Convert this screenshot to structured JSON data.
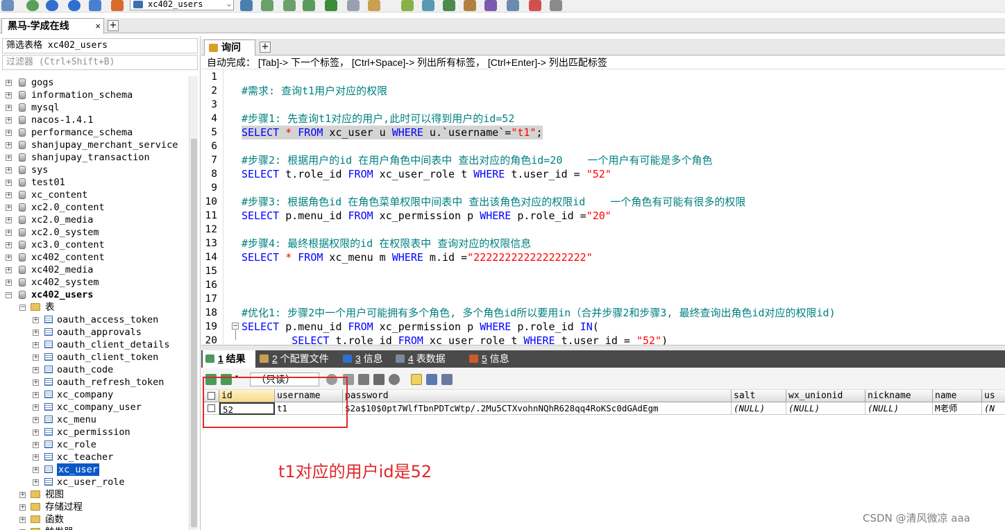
{
  "toolbar": {
    "db_select": "xc402_users"
  },
  "connection_tab": {
    "label": "黑马-学成在线",
    "close": "×"
  },
  "left_panel": {
    "filter_table": "筛选表格 xc402_users",
    "filter_placeholder": "过滤器 (Ctrl+Shift+B)",
    "databases": [
      "gogs",
      "information_schema",
      "mysql",
      "nacos-1.4.1",
      "performance_schema",
      "shanjupay_merchant_service",
      "shanjupay_transaction",
      "sys",
      "test01",
      "xc_content",
      "xc2.0_content",
      "xc2.0_media",
      "xc2.0_system",
      "xc3.0_content",
      "xc402_content",
      "xc402_media",
      "xc402_system",
      "xc402_users"
    ],
    "tables_folder": "表",
    "tables": [
      "oauth_access_token",
      "oauth_approvals",
      "oauth_client_details",
      "oauth_client_token",
      "oauth_code",
      "oauth_refresh_token",
      "xc_company",
      "xc_company_user",
      "xc_menu",
      "xc_permission",
      "xc_role",
      "xc_teacher",
      "xc_user",
      "xc_user_role"
    ],
    "selected_table": "xc_user",
    "other_folders": [
      "视图",
      "存储过程",
      "函数",
      "触发器"
    ]
  },
  "query_tab": {
    "label": "询问",
    "add": "+"
  },
  "hint": "自动完成： [Tab]-> 下一个标签， [Ctrl+Space]-> 列出所有标签， [Ctrl+Enter]-> 列出匹配标签",
  "editor": {
    "line_numbers": [
      "1",
      "2",
      "3",
      "4",
      "5",
      "6",
      "7",
      "8",
      "9",
      "10",
      "11",
      "12",
      "13",
      "14",
      "15",
      "16",
      "17",
      "18",
      "19",
      "20"
    ],
    "lines": [
      [],
      [
        {
          "t": "#需求: 查询t1用户对应的权限",
          "c": "cm"
        }
      ],
      [],
      [
        {
          "t": "#步骤1: 先查询t1对应的用户,此时可以得到用户的id=52",
          "c": "cm"
        }
      ],
      [
        {
          "t": "SELECT",
          "c": "kw"
        },
        {
          "t": " "
        },
        {
          "t": "*",
          "c": "st"
        },
        {
          "t": " "
        },
        {
          "t": "FROM",
          "c": "kw"
        },
        {
          "t": " xc_user u "
        },
        {
          "t": "WHERE",
          "c": "kw"
        },
        {
          "t": " u.`username`="
        },
        {
          "t": "\"t1\"",
          "c": "st"
        },
        {
          "t": ";"
        }
      ],
      [],
      [
        {
          "t": "#步骤2: 根据用户的id 在用户角色中间表中 查出对应的角色id=20    一个用户有可能是多个角色",
          "c": "cm"
        }
      ],
      [
        {
          "t": "SELECT",
          "c": "kw"
        },
        {
          "t": " t.role_id "
        },
        {
          "t": "FROM",
          "c": "kw"
        },
        {
          "t": " xc_user_role t "
        },
        {
          "t": "WHERE",
          "c": "kw"
        },
        {
          "t": " t.user_id = "
        },
        {
          "t": "\"52\"",
          "c": "st"
        }
      ],
      [],
      [
        {
          "t": "#步骤3: 根据角色id 在角色菜单权限中间表中 查出该角色对应的权限id    一个角色有可能有很多的权限",
          "c": "cm"
        }
      ],
      [
        {
          "t": "SELECT",
          "c": "kw"
        },
        {
          "t": " p.menu_id "
        },
        {
          "t": "FROM",
          "c": "kw"
        },
        {
          "t": " xc_permission p "
        },
        {
          "t": "WHERE",
          "c": "kw"
        },
        {
          "t": " p.role_id ="
        },
        {
          "t": "\"20\"",
          "c": "st"
        }
      ],
      [],
      [
        {
          "t": "#步骤4: 最终根据权限的id 在权限表中 查询对应的权限信息",
          "c": "cm"
        }
      ],
      [
        {
          "t": "SELECT",
          "c": "kw"
        },
        {
          "t": " "
        },
        {
          "t": "*",
          "c": "st"
        },
        {
          "t": " "
        },
        {
          "t": "FROM",
          "c": "kw"
        },
        {
          "t": " xc_menu m "
        },
        {
          "t": "WHERE",
          "c": "kw"
        },
        {
          "t": " m.id ="
        },
        {
          "t": "\"222222222222222222\"",
          "c": "st"
        }
      ],
      [],
      [],
      [],
      [
        {
          "t": "#优化1: 步骤2中一个用户可能拥有多个角色, 多个角色id所以要用in（合并步骤2和步骤3, 最终查询出角色id对应的权限id)",
          "c": "cm"
        }
      ],
      [
        {
          "t": "SELECT",
          "c": "kw"
        },
        {
          "t": " p.menu_id "
        },
        {
          "t": "FROM",
          "c": "kw"
        },
        {
          "t": " xc_permission p "
        },
        {
          "t": "WHERE",
          "c": "kw"
        },
        {
          "t": " p.role_id "
        },
        {
          "t": "IN",
          "c": "kw"
        },
        {
          "t": "("
        }
      ],
      [
        {
          "t": "        "
        },
        {
          "t": "SELECT",
          "c": "kw"
        },
        {
          "t": " t.role_id "
        },
        {
          "t": "FROM",
          "c": "kw"
        },
        {
          "t": " xc_user_role t "
        },
        {
          "t": "WHERE",
          "c": "kw"
        },
        {
          "t": " t.user_id = "
        },
        {
          "t": "\"52\"",
          "c": "st"
        },
        {
          "t": ")"
        }
      ]
    ]
  },
  "result_tabs": [
    {
      "num": "1",
      "label": " 结果"
    },
    {
      "num": "2",
      "label": " 个配置文件"
    },
    {
      "num": "3",
      "label": " 信息"
    },
    {
      "num": "4",
      "label": " 表数据"
    },
    {
      "num": "5",
      "label": " 信息"
    }
  ],
  "result_toolbar": {
    "readonly": "（只读）"
  },
  "grid": {
    "columns": [
      "id",
      "username",
      "password",
      "salt",
      "wx_unionid",
      "nickname",
      "name",
      "us"
    ],
    "rows": [
      [
        "52",
        "t1",
        "$2a$10$0pt7WlfTbnPDTcWtp/.2Mu5CTXvohnNQhR628qq4RoKSc0dGAdEgm",
        "(NULL)",
        "(NULL)",
        "(NULL)",
        "M老师",
        "(N"
      ]
    ]
  },
  "annotation": "t1对应的用户id是52",
  "watermark": "CSDN @清风微凉 aaa",
  "colors": {
    "comment": "#008080",
    "keyword": "#0000ff",
    "string": "#ff0000",
    "annotation": "#e02828",
    "selection": "#0a58c8"
  }
}
